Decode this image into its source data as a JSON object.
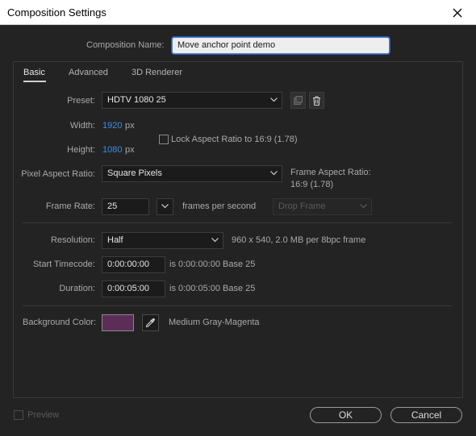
{
  "window": {
    "title": "Composition Settings",
    "close_glyph": "✕"
  },
  "composition_name": {
    "label": "Composition Name:",
    "value": "Move anchor point demo"
  },
  "tabs": [
    {
      "label": "Basic",
      "active": true
    },
    {
      "label": "Advanced",
      "active": false
    },
    {
      "label": "3D Renderer",
      "active": false
    }
  ],
  "preset": {
    "label": "Preset:",
    "value": "HDTV 1080 25",
    "icons": [
      "save-preset-icon",
      "delete-preset-icon"
    ]
  },
  "width": {
    "label": "Width:",
    "value": "1920",
    "unit": "px"
  },
  "height": {
    "label": "Height:",
    "value": "1080",
    "unit": "px"
  },
  "lock_aspect": {
    "label": "Lock Aspect Ratio to 16:9 (1.78)",
    "checked": false
  },
  "pixel_aspect": {
    "label": "Pixel Aspect Ratio:",
    "value": "Square Pixels"
  },
  "frame_aspect": {
    "label": "Frame Aspect Ratio:",
    "value": "16:9 (1.78)"
  },
  "frame_rate": {
    "label": "Frame Rate:",
    "value": "25",
    "unit": "frames per second",
    "drop_frame": "Drop Frame"
  },
  "resolution": {
    "label": "Resolution:",
    "value": "Half",
    "info": "960 x 540, 2.0 MB per 8bpc frame"
  },
  "start_timecode": {
    "label": "Start Timecode:",
    "value": "0:00:00:00",
    "info": "is 0:00:00:00  Base 25"
  },
  "duration": {
    "label": "Duration:",
    "value": "0:00:05:00",
    "info": "is 0:00:05:00  Base 25"
  },
  "background_color": {
    "label": "Background Color:",
    "name": "Medium Gray-Magenta",
    "swatch": "#5c2d57"
  },
  "preview": {
    "label": "Preview",
    "checked": false
  },
  "buttons": {
    "ok": "OK",
    "cancel": "Cancel"
  },
  "colors": {
    "accent_blue": "#3d8ee8",
    "dialog_bg": "#232323"
  }
}
